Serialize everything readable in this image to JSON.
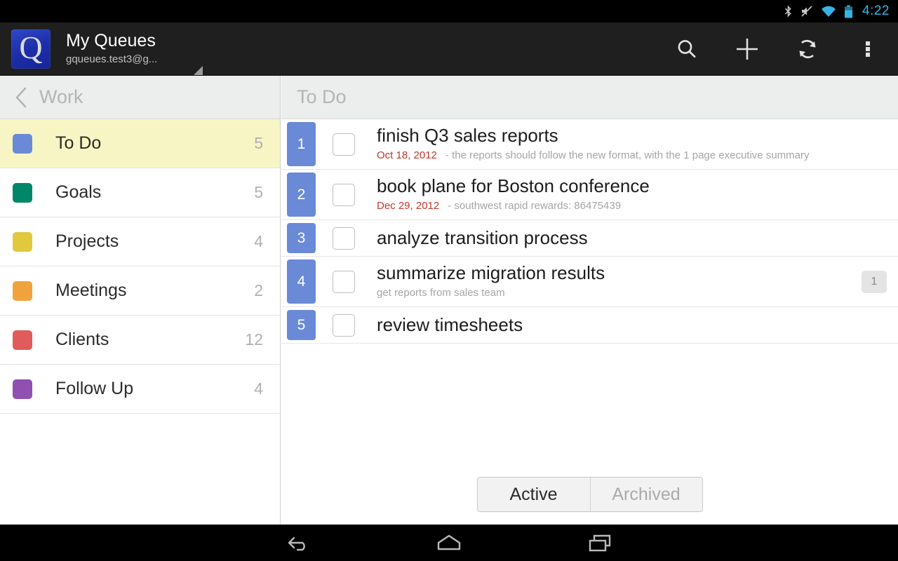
{
  "statusbar": {
    "icons": [
      "bluetooth-icon",
      "mute-icon",
      "wifi-icon",
      "battery-icon"
    ],
    "clock": "4:22",
    "clock_color": "#33b5e5"
  },
  "actionbar": {
    "app_icon_letter": "Q",
    "title": "My Queues",
    "subtitle": "gqueues.test3@g...",
    "spinner_caret": "dropdown-caret-icon",
    "actions": [
      {
        "name": "search-button",
        "icon": "search-icon"
      },
      {
        "name": "add-button",
        "icon": "plus-icon"
      },
      {
        "name": "refresh-button",
        "icon": "refresh-icon"
      },
      {
        "name": "overflow-button",
        "icon": "overflow-menu-icon"
      }
    ]
  },
  "sidebar": {
    "header": {
      "back_icon": "chevron-left-icon",
      "title": "Work"
    },
    "items": [
      {
        "label": "To Do",
        "count": "5",
        "color": "#6a8ad8",
        "selected": true
      },
      {
        "label": "Goals",
        "count": "5",
        "color": "#00876a",
        "selected": false
      },
      {
        "label": "Projects",
        "count": "4",
        "color": "#e2c83c",
        "selected": false
      },
      {
        "label": "Meetings",
        "count": "2",
        "color": "#f0a33c",
        "selected": false
      },
      {
        "label": "Clients",
        "count": "12",
        "color": "#e05c5c",
        "selected": false
      },
      {
        "label": "Follow Up",
        "count": "4",
        "color": "#9050b0",
        "selected": false
      }
    ],
    "selected_bg": "#f7f5c4"
  },
  "list": {
    "header_title": "To Do",
    "number_badge_color": "#6a8ad8",
    "date_color": "#c0392b",
    "tasks": [
      {
        "number": "1",
        "title": "finish Q3 sales reports",
        "date": "Oct 18, 2012",
        "note": "- the reports should follow the new format, with the 1 page executive summary",
        "badge": "",
        "checked": false
      },
      {
        "number": "2",
        "title": "book plane for Boston conference",
        "date": "Dec 29, 2012",
        "note": "- southwest rapid rewards: 86475439",
        "badge": "",
        "checked": false
      },
      {
        "number": "3",
        "title": "analyze transition process",
        "date": "",
        "note": "",
        "badge": "",
        "checked": false
      },
      {
        "number": "4",
        "title": "summarize migration results",
        "date": "",
        "note": "get reports from sales team",
        "badge": "1",
        "checked": false
      },
      {
        "number": "5",
        "title": "review timesheets",
        "date": "",
        "note": "",
        "badge": "",
        "checked": false
      }
    ],
    "filter": {
      "active_label": "Active",
      "archived_label": "Archived",
      "selected": "Active"
    }
  },
  "navbar": {
    "back": "back-icon",
    "home": "home-icon",
    "recents": "recent-apps-icon"
  }
}
